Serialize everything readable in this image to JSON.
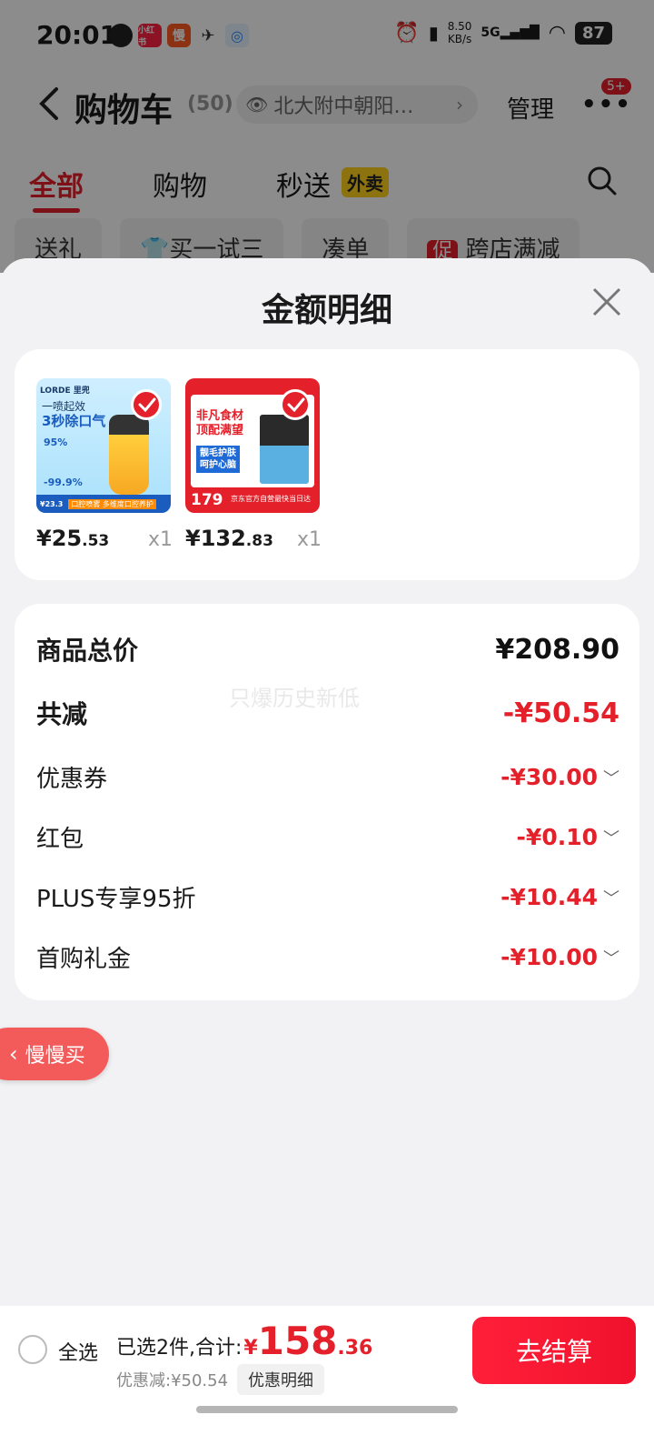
{
  "status_bar": {
    "time": "20:01",
    "apps": [
      {
        "icon": "q-app-icon",
        "label": "",
        "color": "#222222"
      },
      {
        "icon": "xiaohongshu-icon",
        "label": "小红书",
        "color": "#ff2442"
      },
      {
        "icon": "slow-app-icon",
        "label": "慢",
        "color": "#ff5a1f"
      },
      {
        "icon": "bird-app-icon",
        "label": "",
        "color": "#333333"
      },
      {
        "icon": "chat-app-icon",
        "label": "",
        "color": "#2b8cff"
      }
    ],
    "net_speed": "8.50",
    "net_unit": "KB/s",
    "network": "5G",
    "battery": "87"
  },
  "header": {
    "title": "购物车",
    "count": "(50)",
    "address": "北大附中朝阳…",
    "manage": "管理",
    "badge": "5+"
  },
  "tabs": {
    "all": "全部",
    "shop": "购物",
    "fast": "秒送",
    "takeout": "外卖"
  },
  "chips": [
    "送礼",
    "买一试三",
    "凑单",
    "跨店满减"
  ],
  "chip_tag": "促",
  "sheet": {
    "title": "金额明细",
    "products": [
      {
        "price_int": "¥25",
        "price_dec": ".53",
        "qty": "x1",
        "thumb": {
          "brand": "LORDE 里兜",
          "line1": "一喷起效",
          "line2": "3秒除口气",
          "p1": "95%",
          "p2": "-99.9%",
          "footer_price": "¥23.3",
          "footer_text": "口腔喷雾 多维度口腔养护"
        }
      },
      {
        "price_int": "¥132",
        "price_dec": ".83",
        "qty": "x1",
        "thumb": {
          "line1": "非凡食材",
          "line2": "顶配满望",
          "box1": "靓毛护肤",
          "box2": "呵护心脑",
          "price": "179",
          "footer_text": "京东官方自营最快当日达"
        }
      }
    ],
    "details": {
      "total_label": "商品总价",
      "total_value": "¥208.90",
      "reduce_label": "共减",
      "reduce_value": "-¥50.54",
      "watermark": "只爆历史新低",
      "items": [
        {
          "label": "优惠券",
          "value": "-¥30.00"
        },
        {
          "label": "红包",
          "value": "-¥0.10"
        },
        {
          "label": "PLUS专享95折",
          "value": "-¥10.44"
        },
        {
          "label": "首购礼金",
          "value": "-¥10.00"
        }
      ]
    }
  },
  "slow_buy": "慢慢买",
  "bottom": {
    "select_all": "全选",
    "selected_text": "已选2件,合计:",
    "yen": "¥",
    "total_int": "158",
    "total_dec": ".36",
    "discount_text": "优惠减:¥50.54",
    "detail_btn": "优惠明细",
    "checkout": "去结算"
  },
  "colors": {
    "accent": "#e4202a",
    "checkout": "#f0122c",
    "takeout_tag": "#ffd21c"
  }
}
